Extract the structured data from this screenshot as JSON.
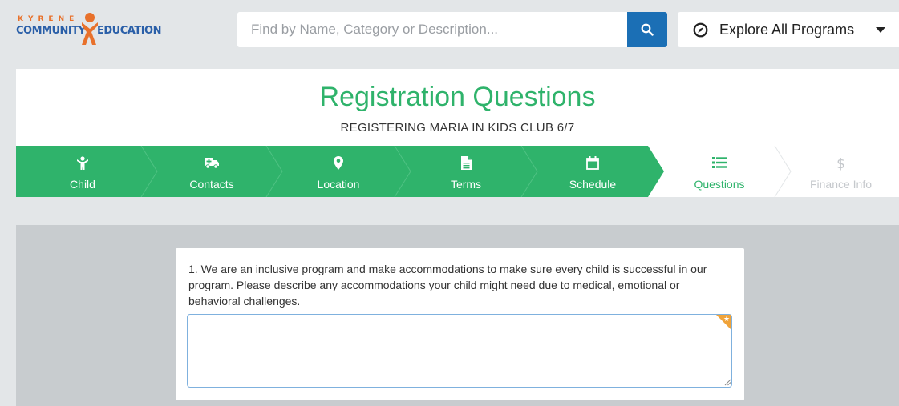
{
  "header": {
    "logo": {
      "line1": "KYRENE",
      "line2a": "COMMUNITY",
      "line2b": "EDUCATION"
    },
    "search": {
      "placeholder": "Find by Name, Category or Description...",
      "value": "",
      "button_icon": "search-icon"
    },
    "explore": {
      "label": "Explore All Programs",
      "icon": "compass-icon"
    }
  },
  "page": {
    "title": "Registration Questions",
    "subtitle": "REGISTERING MARIA IN KIDS CLUB 6/7"
  },
  "steps": [
    {
      "label": "Child",
      "icon": "child-icon",
      "state": "done"
    },
    {
      "label": "Contacts",
      "icon": "ambulance-icon",
      "state": "done"
    },
    {
      "label": "Location",
      "icon": "map-marker-icon",
      "state": "done"
    },
    {
      "label": "Terms",
      "icon": "document-icon",
      "state": "done"
    },
    {
      "label": "Schedule",
      "icon": "calendar-icon",
      "state": "done"
    },
    {
      "label": "Questions",
      "icon": "list-icon",
      "state": "active"
    },
    {
      "label": "Finance Info",
      "icon": "dollar-icon",
      "state": "future"
    }
  ],
  "question": {
    "number": "1.",
    "text": "We are an inclusive program and make accommodations to make sure every child is successful in our program. Please describe any accommodations your child might need due to medical, emotional or behavioral challenges.",
    "answer": "",
    "required_icon": "star-icon"
  },
  "colors": {
    "accent_green": "#2fb36b",
    "search_blue": "#1b6fb5",
    "required_orange": "#f0a33a",
    "logo_blue": "#2a5fa8",
    "logo_orange": "#e8712b"
  }
}
